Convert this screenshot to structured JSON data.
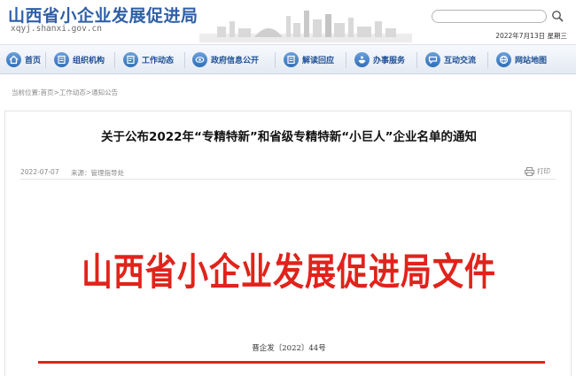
{
  "header": {
    "site_title": "山西省小企业发展促进局",
    "site_url": "xqyj.shanxi.gov.cn",
    "search": {
      "value": "",
      "placeholder": ""
    },
    "date": "2022年7月13日 星期三"
  },
  "nav": {
    "items": [
      {
        "label": "首页",
        "icon": "home-icon"
      },
      {
        "label": "组织机构",
        "icon": "organization-icon"
      },
      {
        "label": "工作动态",
        "icon": "work-news-icon"
      },
      {
        "label": "政府信息公开",
        "icon": "info-disclosure-icon"
      },
      {
        "label": "解读回应",
        "icon": "interpretation-icon"
      },
      {
        "label": "办事服务",
        "icon": "service-icon"
      },
      {
        "label": "互动交流",
        "icon": "interaction-icon"
      },
      {
        "label": "网站地图",
        "icon": "sitemap-icon"
      }
    ]
  },
  "breadcrumb": {
    "prefix": "当前位置:",
    "items": [
      "首页",
      "工作动态",
      "通知公告"
    ],
    "separator": ">"
  },
  "article": {
    "title": "关于公布2022年“专精特新”和省级专精特新“小巨人”企业名单的通知",
    "date": "2022-07-07",
    "source": "来源：管理指导处",
    "print_label": "打印",
    "doc_header": "山西省小企业发展促进局文件",
    "doc_number": "晋企发〔2022〕44号"
  },
  "colors": {
    "brand_blue": "#2f5fa7",
    "nav_text": "#1d4f95",
    "doc_red": "#e0231b"
  }
}
